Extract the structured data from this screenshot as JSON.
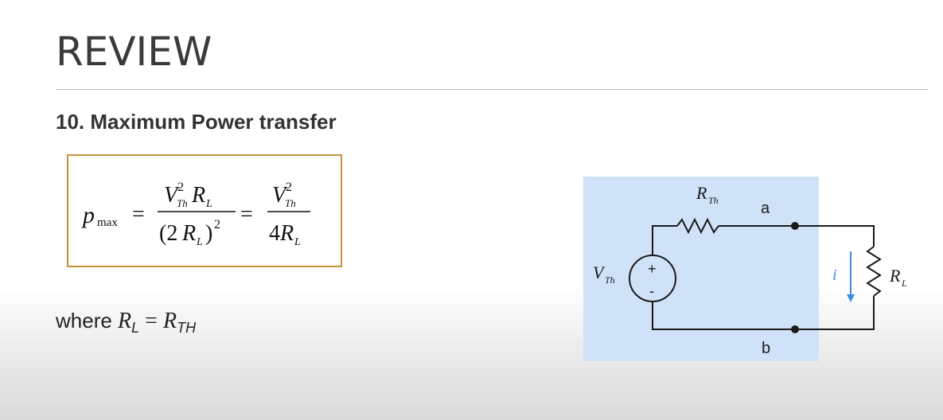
{
  "slide": {
    "title": "REVIEW",
    "section_heading": "10. Maximum Power transfer"
  },
  "formula": {
    "lhs": "p",
    "lhs_sub": "max",
    "eq1": "=",
    "num1_v": "V",
    "num1_v_sup": "2",
    "num1_v_sub": "Th",
    "num1_r": "R",
    "num1_r_sub": "L",
    "den1_open": "(2",
    "den1_r": "R",
    "den1_r_sub": "L",
    "den1_close": ")",
    "den1_sup": "2",
    "eq2": "=",
    "num2_v": "V",
    "num2_v_sup": "2",
    "num2_v_sub": "Th",
    "den2_coef": "4",
    "den2_r": "R",
    "den2_r_sub": "L"
  },
  "condition": {
    "prefix": "where ",
    "lhs": "R",
    "lhs_sub": "L",
    "eq": " = ",
    "rhs": "R",
    "rhs_sub": "TH"
  },
  "circuit": {
    "source_label": "V",
    "source_label_sub": "Th",
    "source_plus": "+",
    "source_minus": "-",
    "resistor_label": "R",
    "resistor_label_sub": "Th",
    "load_label": "R",
    "load_label_sub": "L",
    "node_a": "a",
    "node_b": "b",
    "current_label": "i",
    "colors": {
      "background": "#cfe2f8",
      "wire": "#1a1a1a",
      "current_arrow": "#3a8de0"
    }
  },
  "colors": {
    "formula_border": "#c8923b",
    "rule": "#bdbdbd"
  }
}
